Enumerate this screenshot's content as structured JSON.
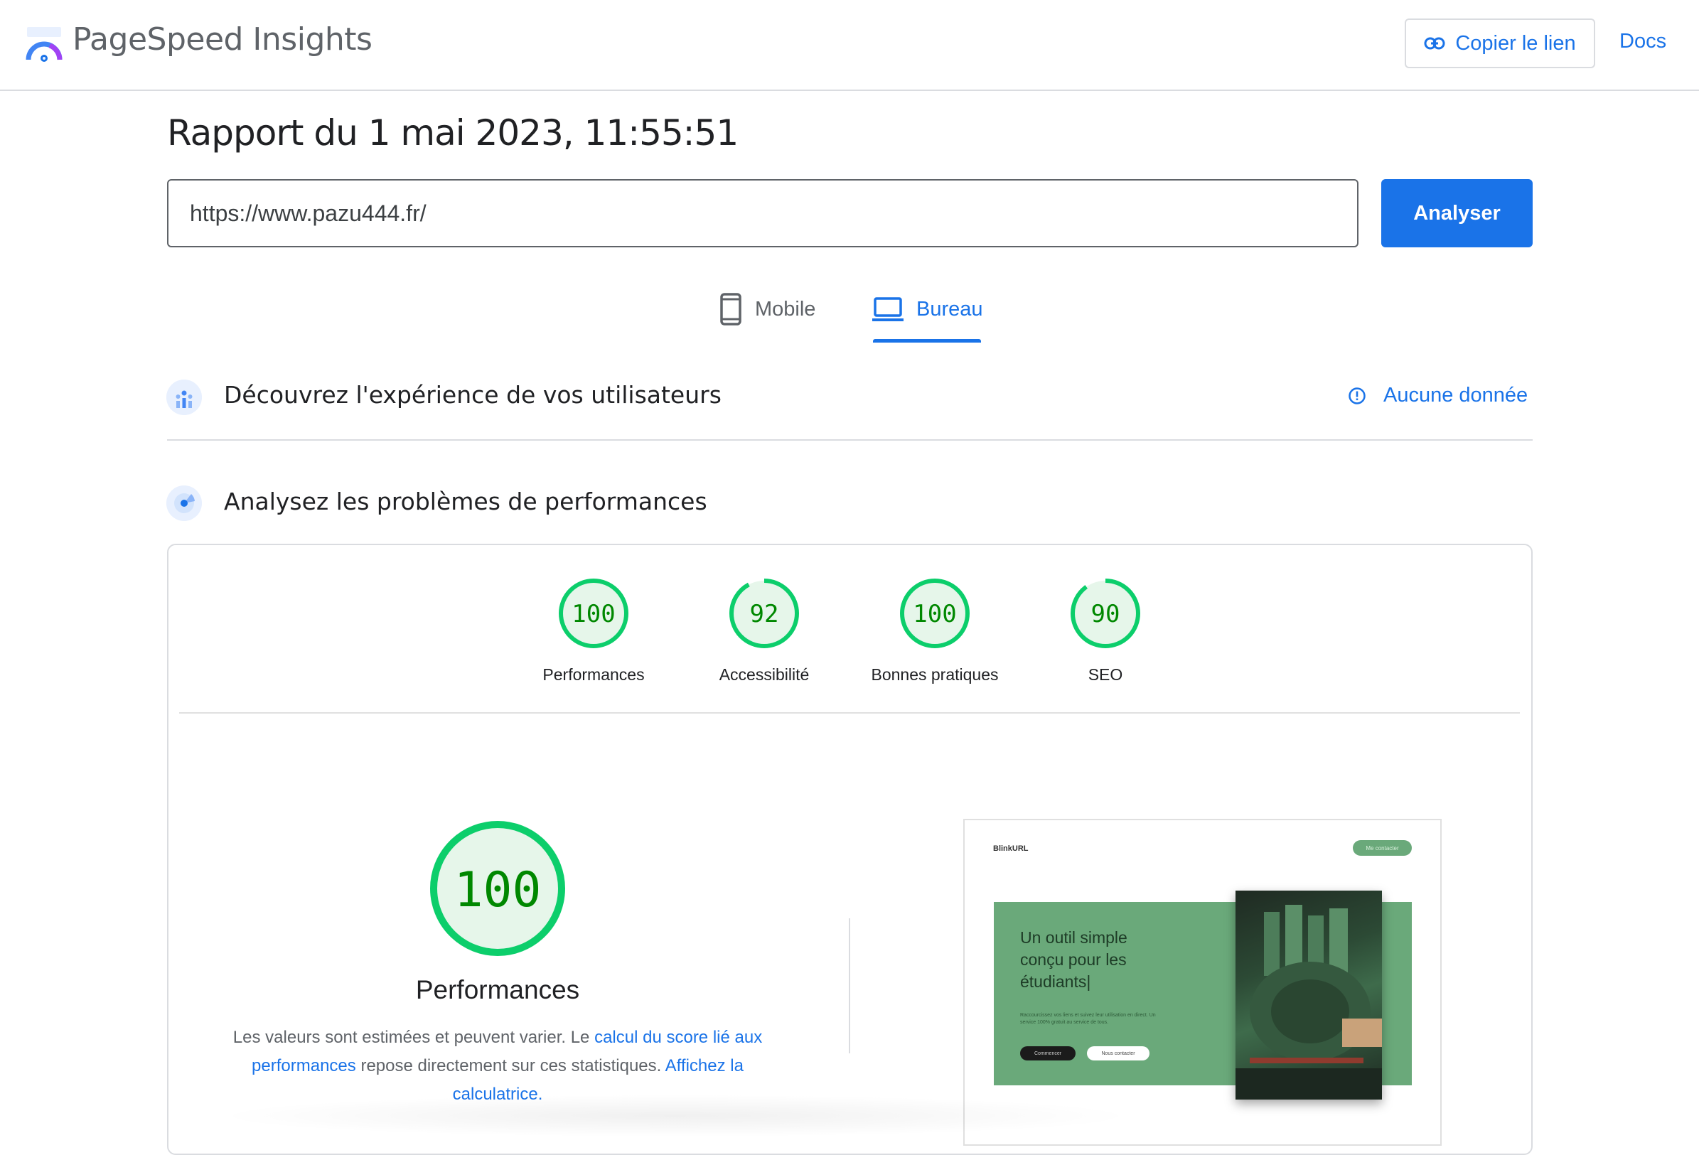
{
  "header": {
    "app_title": "PageSpeed Insights",
    "copy_link_label": "Copier le lien",
    "docs_label": "Docs"
  },
  "report": {
    "title": "Rapport du 1 mai 2023, 11:55:51",
    "url_value": "https://www.pazu444.fr/",
    "analyze_label": "Analyser"
  },
  "tabs": [
    {
      "label": "Mobile",
      "icon": "smartphone-icon",
      "selected": false
    },
    {
      "label": "Bureau",
      "icon": "laptop-icon",
      "selected": true
    }
  ],
  "sections": {
    "field_data": {
      "title": "Découvrez l'expérience de vos utilisateurs",
      "status": "Aucune donnée",
      "icon": "users-chart-icon"
    },
    "lab_data": {
      "title": "Analysez les problèmes de performances",
      "icon": "radar-icon"
    }
  },
  "scores": [
    {
      "value": "100",
      "label": "Performances"
    },
    {
      "value": "92",
      "label": "Accessibilité"
    },
    {
      "value": "100",
      "label": "Bonnes pratiques"
    },
    {
      "value": "90",
      "label": "SEO"
    }
  ],
  "performance": {
    "score": "100",
    "title": "Performances",
    "desc_part1": "Les valeurs sont estimées et peuvent varier. Le ",
    "desc_link1": "calcul du score lié aux performances",
    "desc_part2": " repose directement sur ces statistiques. ",
    "desc_link2": "Affichez la calculatrice."
  },
  "thumbnail": {
    "brand": "BlinkURL",
    "nav_button": "Me contacter",
    "headline": "Un outil simple conçu pour les étudiants|",
    "subtext": "Raccourcissez vos liens et suivez leur utilisation en direct. Un service 100% gratuit au service de tous.",
    "primary_button": "Commencer",
    "secondary_button": "Nous contacter"
  },
  "colors": {
    "accent": "#1a73e8",
    "score_good": "#0cce6b",
    "score_text": "#008800",
    "hero_green": "#6aa97a"
  }
}
